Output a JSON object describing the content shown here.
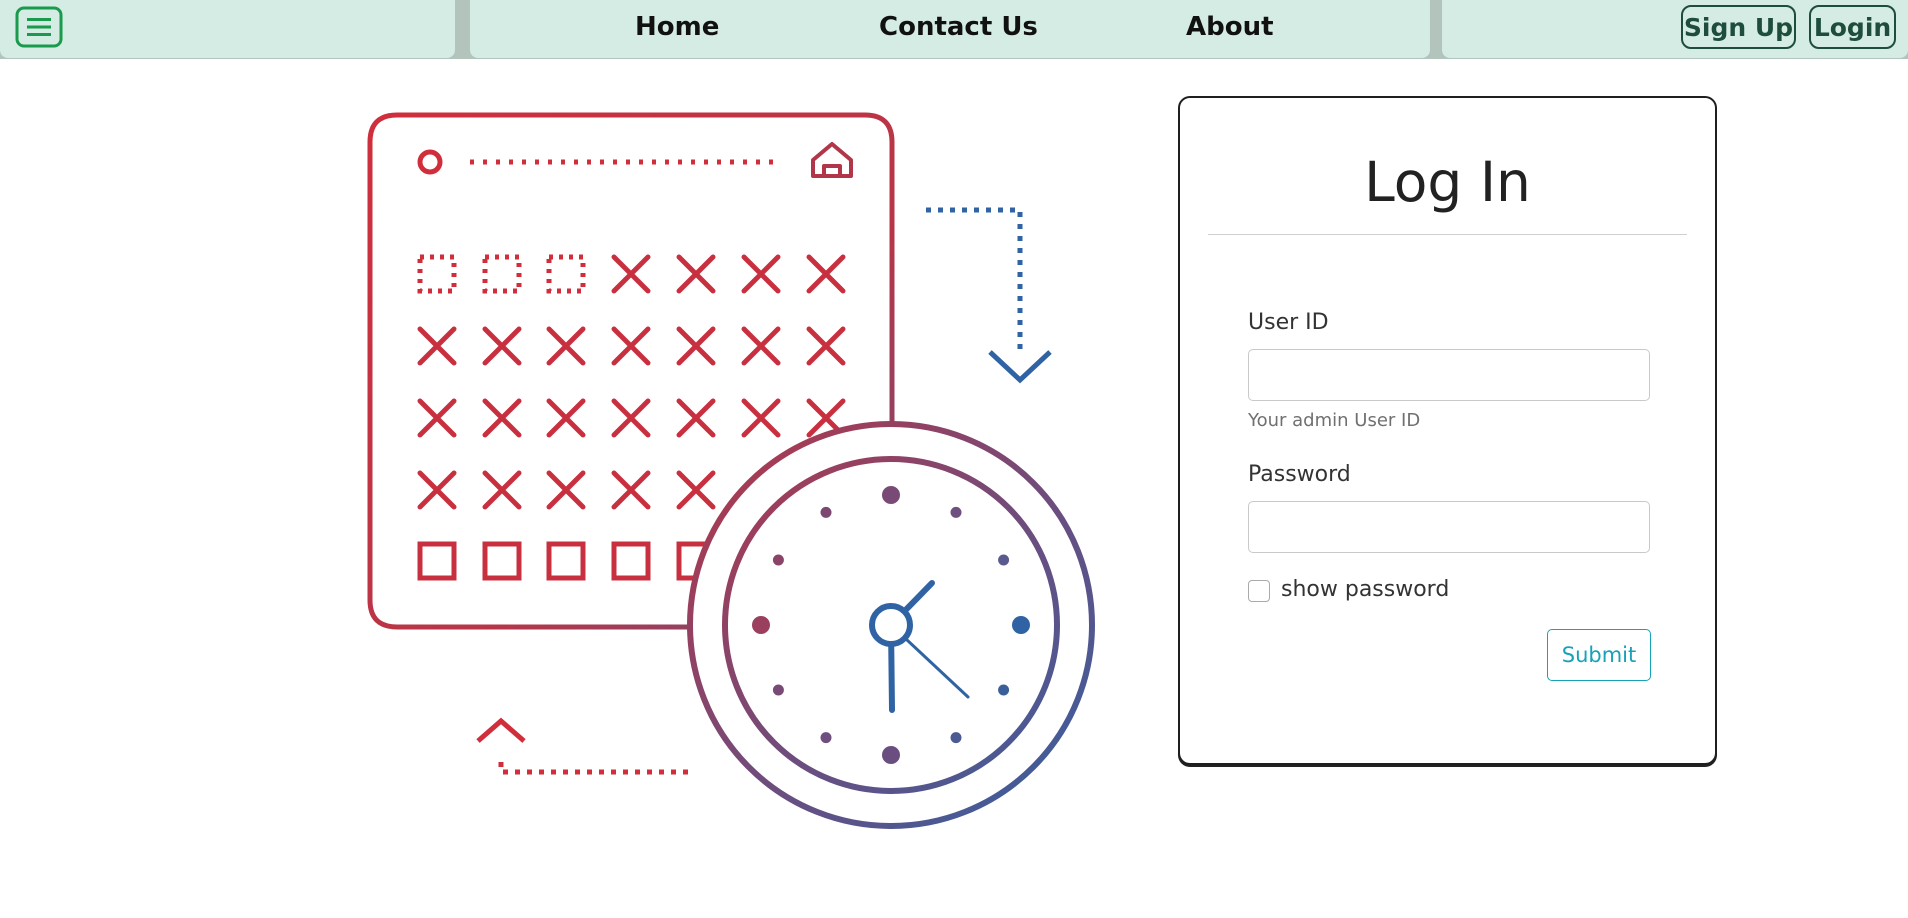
{
  "nav": {
    "menu_icon": "menu-list-icon",
    "links": [
      {
        "label": "Home"
      },
      {
        "label": "Contact Us"
      },
      {
        "label": "About"
      }
    ],
    "signup_label": "Sign Up",
    "login_label": "Login"
  },
  "illustration": {
    "icons": [
      "calendar-icon",
      "clock-icon",
      "home-icon",
      "arrow-down-icon",
      "arrow-up-icon"
    ]
  },
  "login_form": {
    "title": "Log In",
    "user_id_label": "User ID",
    "user_id_value": "",
    "user_id_hint": "Your admin User ID",
    "password_label": "Password",
    "password_value": "",
    "show_password_label": "show password",
    "show_password_checked": false,
    "submit_label": "Submit"
  },
  "colors": {
    "nav_bg": "#d4ece4",
    "nav_text": "#1e4d3c",
    "menu_icon": "#1a9a4c",
    "illustration_red": "#d12e3c",
    "illustration_blue": "#2f63a4",
    "submit_accent": "#17a2b8"
  }
}
